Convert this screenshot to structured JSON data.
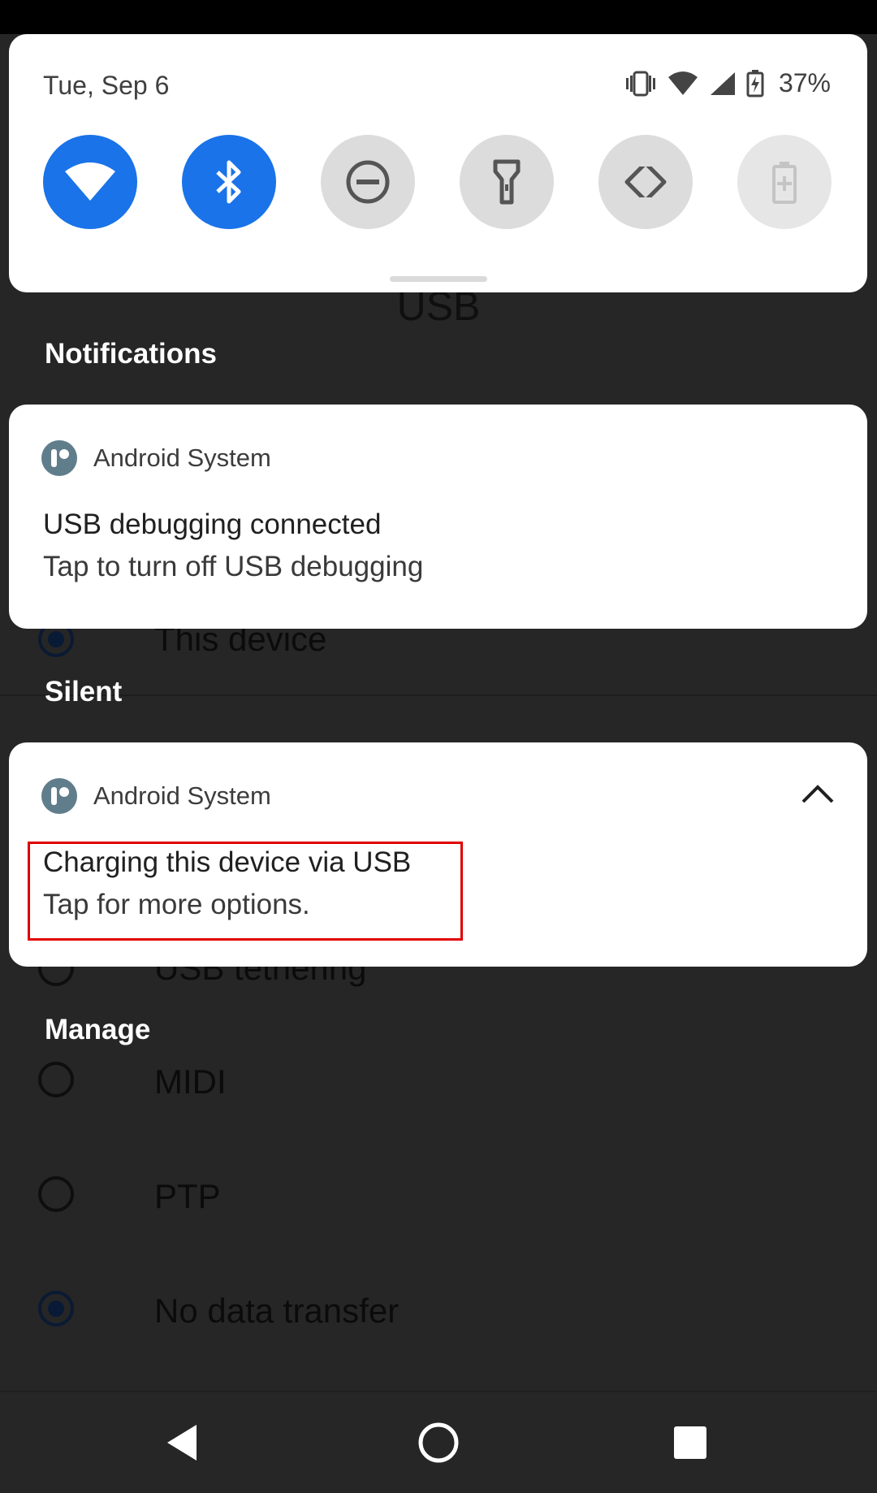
{
  "background_screen": {
    "title": "USB",
    "options_visible": [
      {
        "label": "This device",
        "checked": true
      },
      {
        "label": "USB tethering",
        "checked": false
      },
      {
        "label": "MIDI",
        "checked": false
      },
      {
        "label": "PTP",
        "checked": false
      },
      {
        "label": "No data transfer",
        "checked": true
      }
    ]
  },
  "quick_settings": {
    "date": "Tue, Sep 6",
    "battery_percent": "37%",
    "status_icons": [
      "vibrate-icon",
      "wifi-signal-icon",
      "cell-signal-icon",
      "battery-charging-icon"
    ],
    "tiles": [
      {
        "name": "wifi",
        "icon": "wifi-icon",
        "state": "on"
      },
      {
        "name": "bluetooth",
        "icon": "bluetooth-icon",
        "state": "on"
      },
      {
        "name": "do-not-disturb",
        "icon": "dnd-icon",
        "state": "off"
      },
      {
        "name": "flashlight",
        "icon": "flashlight-icon",
        "state": "off"
      },
      {
        "name": "auto-rotate",
        "icon": "rotate-icon",
        "state": "off"
      },
      {
        "name": "battery-saver",
        "icon": "battery-saver-icon",
        "state": "disabled"
      }
    ]
  },
  "sections": {
    "notifications_header": "Notifications",
    "silent_header": "Silent",
    "manage_header": "Manage"
  },
  "notifications": [
    {
      "app": "Android System",
      "title": "USB debugging connected",
      "text": "Tap to turn off USB debugging"
    },
    {
      "app": "Android System",
      "title": "Charging this device via USB",
      "text": "Tap for more options.",
      "expanded": true
    }
  ],
  "colors": {
    "accent": "#1a73e8",
    "highlight": "#e00000",
    "scrim": "#262626"
  }
}
